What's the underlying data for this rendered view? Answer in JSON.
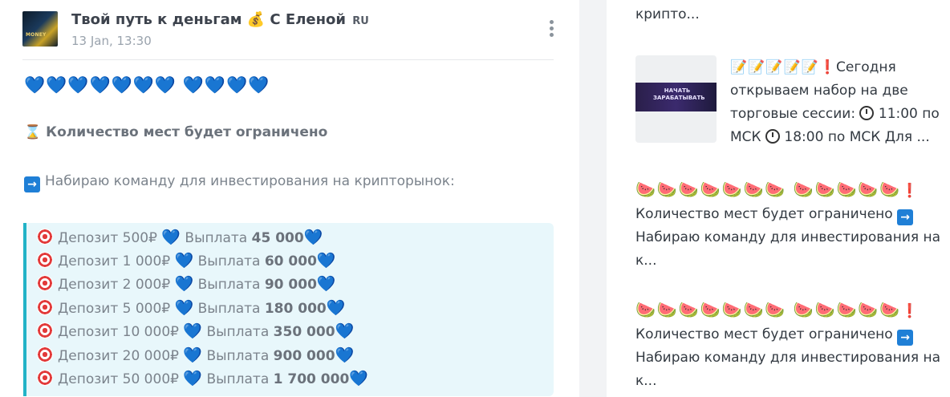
{
  "post": {
    "channel_title": "Твой путь к деньгам 💰 С Еленой",
    "lang_badge": "RU",
    "date": "13 Jan, 13:30",
    "hearts": "💙💙💙💙💙💙💙 💙💙💙💙",
    "limited_text": "Количество мест будет ограничено",
    "recruit_text": "Набираю команду для инвестирования на крипторынок:",
    "rows": [
      {
        "deposit": "Депозит 500₽",
        "payout_label": "Выплата",
        "payout": "45 000"
      },
      {
        "deposit": "Депозит 1 000₽",
        "payout_label": "Выплата",
        "payout": "60 000"
      },
      {
        "deposit": "Депозит 2 000₽",
        "payout_label": "Выплата",
        "payout": "90 000"
      },
      {
        "deposit": "Депозит 5 000₽",
        "payout_label": "Выплата",
        "payout": "180 000"
      },
      {
        "deposit": "Депозит 10 000₽",
        "payout_label": "Выплата",
        "payout": "350 000"
      },
      {
        "deposit": "Депозит 20 000₽",
        "payout_label": "Выплата",
        "payout": "900 000"
      },
      {
        "deposit": "Депозит 50 000₽",
        "payout_label": "Выплата",
        "payout": "1 700 000"
      }
    ]
  },
  "sidebar": {
    "top_snippet": "крипто...",
    "thumb_text": "НАЧАТЬ ЗАРАБАТЫВАТЬ",
    "post1_text": "Сегодня открываем набор на две торговые сессии:",
    "post1_time1": "11:00 по МСК",
    "post1_time2": "18:00 по МСК Для ...",
    "post2_line1": "Количество мест будет ограничено",
    "post2_line2": "Набираю команду для инвестирования на к...",
    "post3_line1": "Количество мест будет ограничено",
    "post3_line2": "Набираю команду для инвестирования на к..."
  },
  "colors": {
    "heart": "#1d8fe1",
    "quote_border": "#22b3c7",
    "quote_bg": "#e8f7fb"
  }
}
